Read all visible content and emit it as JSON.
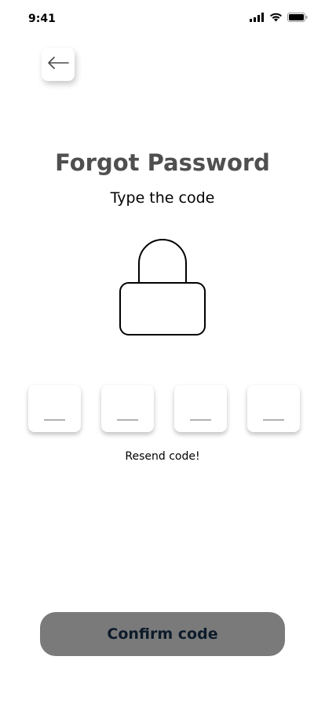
{
  "status_bar": {
    "time": "9:41",
    "icons": [
      "cellular-signal-icon",
      "wifi-icon",
      "battery-icon"
    ]
  },
  "header": {
    "back_icon": "arrow-left-icon"
  },
  "main": {
    "title": "Forgot Password",
    "subtitle": "Type the code",
    "illustration": "lock-icon",
    "code_fields": [
      {
        "value": ""
      },
      {
        "value": ""
      },
      {
        "value": ""
      },
      {
        "value": ""
      }
    ],
    "resend_label": "Resend code!"
  },
  "footer": {
    "confirm_label": "Confirm code"
  },
  "colors": {
    "title": "#4f4f4f",
    "button_bg": "#7a7a7a",
    "button_text": "#0d1b2a"
  }
}
